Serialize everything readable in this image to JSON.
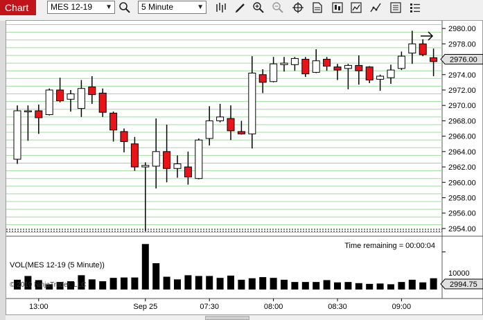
{
  "toolbar": {
    "tab_label": "Chart",
    "instrument": "MES 12-19",
    "interval": "5 Minute",
    "icons": [
      "search-icon",
      "bar-type-icon",
      "draw-pencil-icon",
      "zoom-in-icon",
      "zoom-out-icon",
      "crosshair-icon",
      "properties-icon",
      "indicators-icon",
      "strategies-icon",
      "chart-trader-icon",
      "data-box-icon"
    ]
  },
  "colors": {
    "up_candle": "#ffffff",
    "down_candle": "#e8141a",
    "grid": "#9fdb9f",
    "volume": "#000000",
    "tab": "#c0141a"
  },
  "chart_data": [
    {
      "type": "candlestick",
      "instrument": "MES 12-19",
      "interval": "5 Minute",
      "ylim": [
        2953,
        2981
      ],
      "y_ticks": [
        2954,
        2956,
        2958,
        2960,
        2962,
        2964,
        2966,
        2968,
        2970,
        2972,
        2974,
        2976,
        2978,
        2980
      ],
      "y_tick_labels": [
        "2954.00",
        "2956.00",
        "2958.00",
        "2960.00",
        "2962.00",
        "2964.00",
        "2966.00",
        "2968.00",
        "2970.00",
        "2972.00",
        "2974.00",
        "2976.00",
        "2978.00",
        "2980.00"
      ],
      "x_labels": [
        "13:00",
        "Sep 25",
        "07:30",
        "08:00",
        "08:30",
        "09:00"
      ],
      "x_label_bars": [
        2,
        12,
        18,
        24,
        30,
        36
      ],
      "current_price": "2976.00",
      "time_remaining": "Time remaining = 00:00:04",
      "grid": true,
      "candles": [
        [
          2963.0,
          2969.3,
          2962.4,
          2970.0
        ],
        [
          2969.3,
          2969.3,
          2965.4,
          2970.0
        ],
        [
          2969.3,
          2968.4,
          2966.3,
          2970.1
        ],
        [
          2968.8,
          2972.0,
          2968.7,
          2972.2
        ],
        [
          2972.0,
          2970.6,
          2970.4,
          2973.6
        ],
        [
          2970.8,
          2971.5,
          2969.2,
          2972.0
        ],
        [
          2969.6,
          2972.2,
          2968.5,
          2973.3
        ],
        [
          2972.4,
          2971.4,
          2970.2,
          2973.8
        ],
        [
          2971.6,
          2969.1,
          2968.5,
          2972.2
        ],
        [
          2969.0,
          2966.8,
          2965.3,
          2969.2
        ],
        [
          2966.6,
          2965.3,
          2963.9,
          2967.0
        ],
        [
          2965.0,
          2962.0,
          2961.5,
          2965.9
        ],
        [
          2962.0,
          2962.2,
          2953.7,
          2962.6
        ],
        [
          2962.1,
          2964.0,
          2959.2,
          2968.3
        ],
        [
          2964.0,
          2961.8,
          2960.0,
          2967.5
        ],
        [
          2961.8,
          2962.4,
          2960.6,
          2963.5
        ],
        [
          2962.0,
          2960.7,
          2959.7,
          2964.0
        ],
        [
          2960.5,
          2965.5,
          2960.4,
          2965.7
        ],
        [
          2965.7,
          2968.0,
          2964.8,
          2969.9
        ],
        [
          2968.0,
          2968.5,
          2967.8,
          2970.2
        ],
        [
          2968.3,
          2966.7,
          2965.5,
          2970.0
        ],
        [
          2966.6,
          2966.3,
          2966.2,
          2968.0
        ],
        [
          2966.3,
          2974.2,
          2964.4,
          2976.4
        ],
        [
          2974.0,
          2973.0,
          2971.6,
          2974.7
        ],
        [
          2973.1,
          2975.4,
          2973.0,
          2976.3
        ],
        [
          2975.3,
          2975.5,
          2974.4,
          2976.3
        ],
        [
          2975.3,
          2976.1,
          2974.5,
          2976.3
        ],
        [
          2976.0,
          2974.1,
          2973.7,
          2976.3
        ],
        [
          2974.3,
          2975.8,
          2974.2,
          2977.3
        ],
        [
          2976.0,
          2975.1,
          2974.5,
          2976.3
        ],
        [
          2975.0,
          2974.6,
          2973.3,
          2975.4
        ],
        [
          2974.8,
          2975.2,
          2972.1,
          2975.4
        ],
        [
          2975.2,
          2974.5,
          2972.7,
          2976.5
        ],
        [
          2975.0,
          2973.3,
          2972.9,
          2975.1
        ],
        [
          2973.4,
          2973.8,
          2971.9,
          2974.0
        ],
        [
          2973.6,
          2974.6,
          2972.8,
          2975.3
        ],
        [
          2974.8,
          2976.4,
          2974.6,
          2977.0
        ],
        [
          2976.8,
          2978.0,
          2975.4,
          2979.7
        ],
        [
          2978.0,
          2976.6,
          2976.4,
          2978.6
        ],
        [
          2976.2,
          2975.7,
          2973.8,
          2977.4
        ]
      ]
    },
    {
      "type": "bar",
      "title": "VOL(MES 12-19 (5 Minute))",
      "y_tick_label": "10000",
      "ylim": [
        0,
        14000
      ],
      "current_value": "2994.75",
      "overlay_text": "© 2019 NinjaTrader, LLC",
      "values": [
        2600,
        3600,
        2500,
        1400,
        2000,
        2200,
        3800,
        2700,
        2200,
        3100,
        3200,
        3200,
        12100,
        7000,
        3400,
        2700,
        3800,
        3600,
        3600,
        3100,
        3700,
        2600,
        3000,
        3300,
        3100,
        2600,
        2000,
        2000,
        2000,
        2500,
        1900,
        2000,
        1700,
        1500,
        1600,
        1400,
        2000,
        2600,
        1900,
        3000
      ]
    }
  ]
}
